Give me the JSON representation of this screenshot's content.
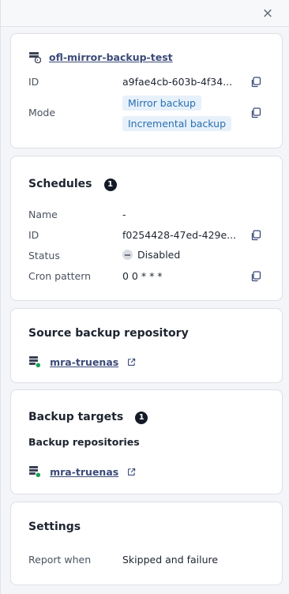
{
  "header": {
    "close_label": "×"
  },
  "summary": {
    "name": "ofl-mirror-backup-test",
    "id_label": "ID",
    "id_value": "a9fae4cb-603b-4f34...",
    "mode_label": "Mode",
    "modes": [
      "Mirror backup",
      "Incremental backup"
    ]
  },
  "schedules": {
    "title": "Schedules",
    "count": "1",
    "name_label": "Name",
    "name_value": "-",
    "id_label": "ID",
    "id_value": "f0254428-47ed-429e...",
    "status_label": "Status",
    "status_value": "Disabled",
    "cron_label": "Cron pattern",
    "cron_value": "0 0 * * *"
  },
  "source": {
    "title": "Source backup repository",
    "repo_link": "mra-truenas"
  },
  "targets": {
    "title": "Backup targets",
    "count": "1",
    "subtitle": "Backup repositories",
    "repo_link": "mra-truenas"
  },
  "settings": {
    "title": "Settings",
    "report_label": "Report when",
    "report_value": "Skipped and failure"
  },
  "colors": {
    "chip_bg": "#e7f1fb",
    "chip_text": "#2a6fb0",
    "badge_bg": "#141a26",
    "link": "#3b4a78",
    "status_ok": "#1f9d55"
  }
}
